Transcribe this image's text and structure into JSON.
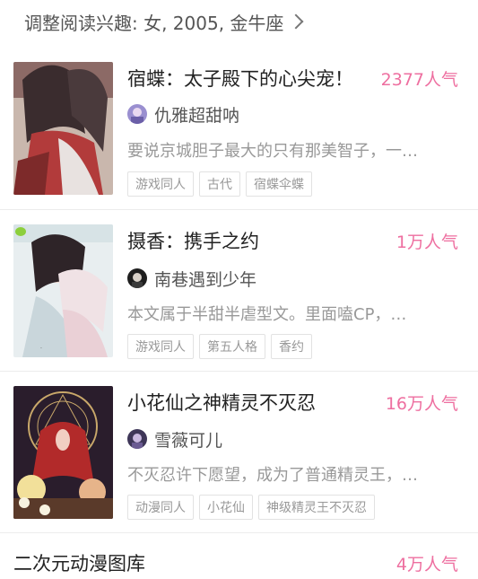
{
  "header": {
    "label": "调整阅读兴趣: 女, 2005, 金牛座"
  },
  "books": [
    {
      "title": "宿蝶：太子殿下的心尖宠！",
      "popularity": "2377人气",
      "author": "仇雅超甜呐",
      "description": "要说京城胆子最大的只有那美智子，一…",
      "tags": [
        "游戏同人",
        "古代",
        "宿蝶伞蝶"
      ]
    },
    {
      "title": "摄香：携手之约",
      "popularity": "1万人气",
      "author": "南巷遇到少年",
      "description": "本文属于半甜半虐型文。里面嗑CP，…",
      "tags": [
        "游戏同人",
        "第五人格",
        "香约"
      ]
    },
    {
      "title": "小花仙之神精灵不灭忍",
      "popularity": "16万人气",
      "author": "雪薇可儿",
      "description": "不灭忍许下愿望，成为了普通精灵王，…",
      "tags": [
        "动漫同人",
        "小花仙",
        "神级精灵王不灭忍"
      ]
    }
  ],
  "bottom": {
    "title": "二次元动漫图库",
    "popularity": "4万人气"
  },
  "colors": {
    "accent": "#ee6fa0",
    "muted": "#999999"
  }
}
